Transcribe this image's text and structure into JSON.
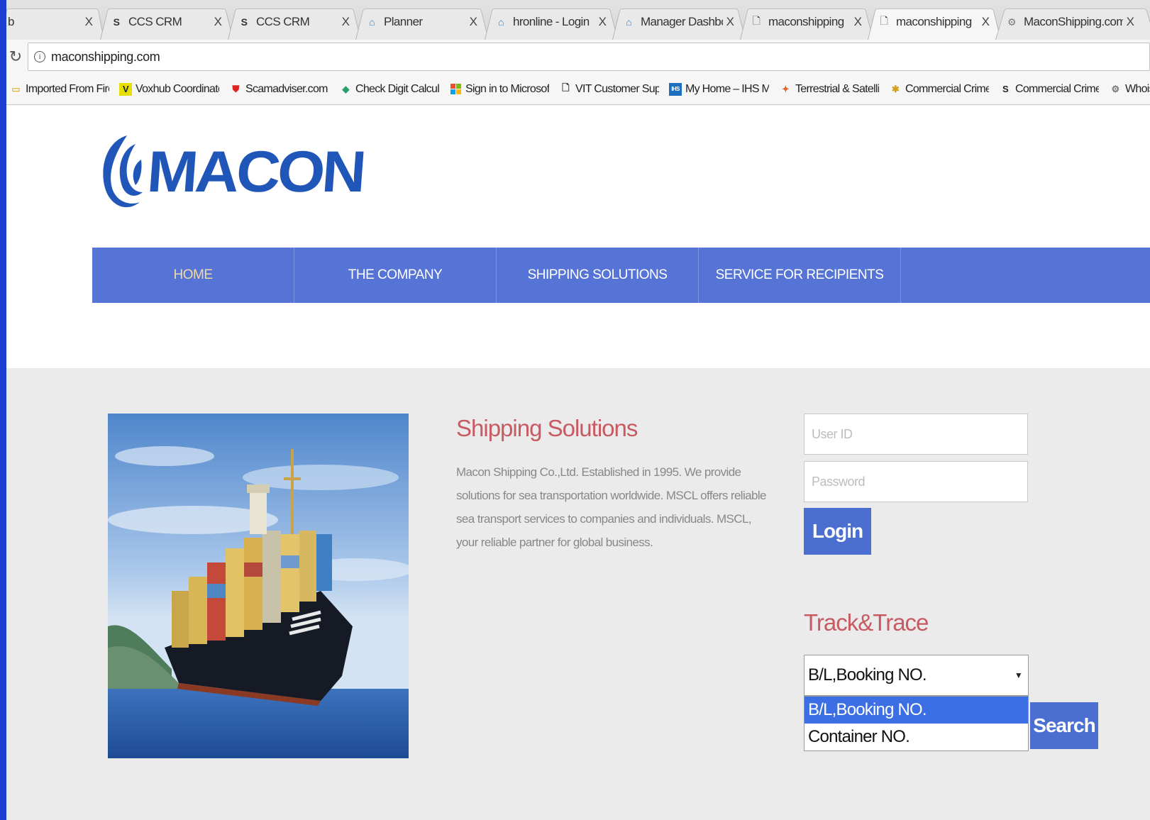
{
  "browser": {
    "tabs": [
      {
        "title": "CCS CRM",
        "icon": "ccs-icon",
        "active": false
      },
      {
        "title": "CCS CRM",
        "icon": "ccs-icon",
        "active": false
      },
      {
        "title": "Planner",
        "icon": "planner-icon",
        "active": false
      },
      {
        "title": "hronline - Login",
        "icon": "home-icon",
        "active": false
      },
      {
        "title": "Manager Dashboard - h",
        "icon": "home-icon",
        "active": false
      },
      {
        "title": "maconshipping",
        "icon": "page-icon",
        "active": false
      },
      {
        "title": "maconshipping",
        "icon": "page-icon",
        "active": true
      },
      {
        "title": "MaconShipping.com Wh",
        "icon": "gear-icon",
        "active": false
      }
    ],
    "first_tab_fragment": "b",
    "close_glyph": "X",
    "url": "maconshipping.com",
    "bookmarks": [
      {
        "label": "Imported From Firefox",
        "icon": "folder-icon"
      },
      {
        "label": "Voxhub Coordinator E",
        "icon": "v-icon"
      },
      {
        "label": "Scamadviser.com | ch",
        "icon": "shield-icon"
      },
      {
        "label": "Check Digit Calculato",
        "icon": "diamond-icon"
      },
      {
        "label": "Sign in to Microsoft C",
        "icon": "windows-icon"
      },
      {
        "label": "VIT Customer Suppor",
        "icon": "page-icon"
      },
      {
        "label": "My Home – IHS Marit",
        "icon": "ihs-icon"
      },
      {
        "label": "Terrestrial & Satellite",
        "icon": "satellite-icon"
      },
      {
        "label": "Commercial Crime Se",
        "icon": "star-icon"
      },
      {
        "label": "Commercial Crime Se",
        "icon": "ccs-icon"
      },
      {
        "label": "Whois Lookup, Doma",
        "icon": "gear-icon"
      }
    ]
  },
  "site": {
    "logo_text": "MACON",
    "nav": [
      {
        "label": "HOME",
        "active": true
      },
      {
        "label": "THE COMPANY",
        "active": false
      },
      {
        "label": "SHIPPING SOLUTIONS",
        "active": false
      },
      {
        "label": "SERVICE FOR RECIPIENTS",
        "active": false
      }
    ],
    "solutions": {
      "title": "Shipping Solutions",
      "text": "Macon Shipping Co.,Ltd. Established in 1995. We provide solutions for sea transportation worldwide. MSCL offers reliable sea transport services to companies and individuals. MSCL, your reliable partner for global business."
    },
    "login": {
      "user_placeholder": "User ID",
      "password_placeholder": "Password",
      "button": "Login"
    },
    "track": {
      "title": "Track&Trace",
      "selected": "B/L,Booking NO.",
      "options": [
        "B/L,Booking NO.",
        "Container NO."
      ],
      "search_button": "Search"
    }
  },
  "colors": {
    "nav_bg": "#5574d6",
    "accent_red": "#c75a63",
    "button_blue": "#4a6fd0",
    "logo_blue": "#1f56b8",
    "frame_blue": "#1a3fd0"
  }
}
